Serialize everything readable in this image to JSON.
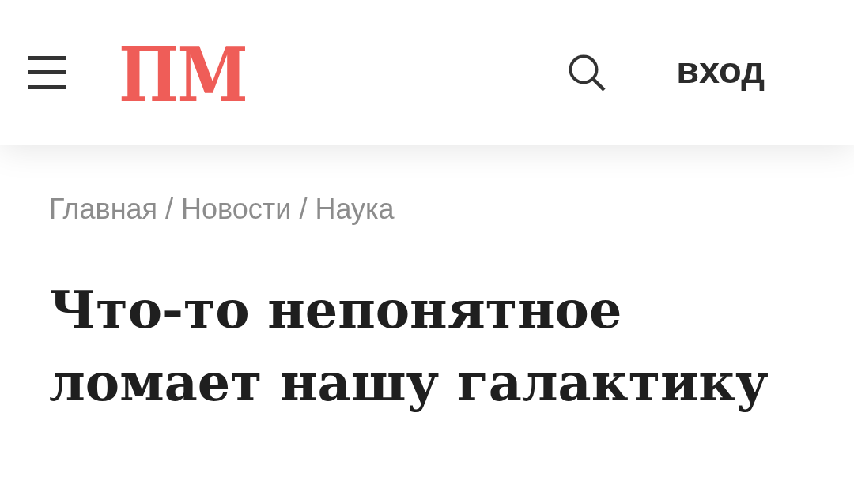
{
  "header": {
    "logo": "ПМ",
    "login": "вход"
  },
  "breadcrumbs": {
    "separator": "/",
    "items": [
      {
        "label": "Главная"
      },
      {
        "label": "Новости"
      },
      {
        "label": "Наука"
      }
    ]
  },
  "article": {
    "title": "Что-то непонятное ломает нашу галактику"
  }
}
